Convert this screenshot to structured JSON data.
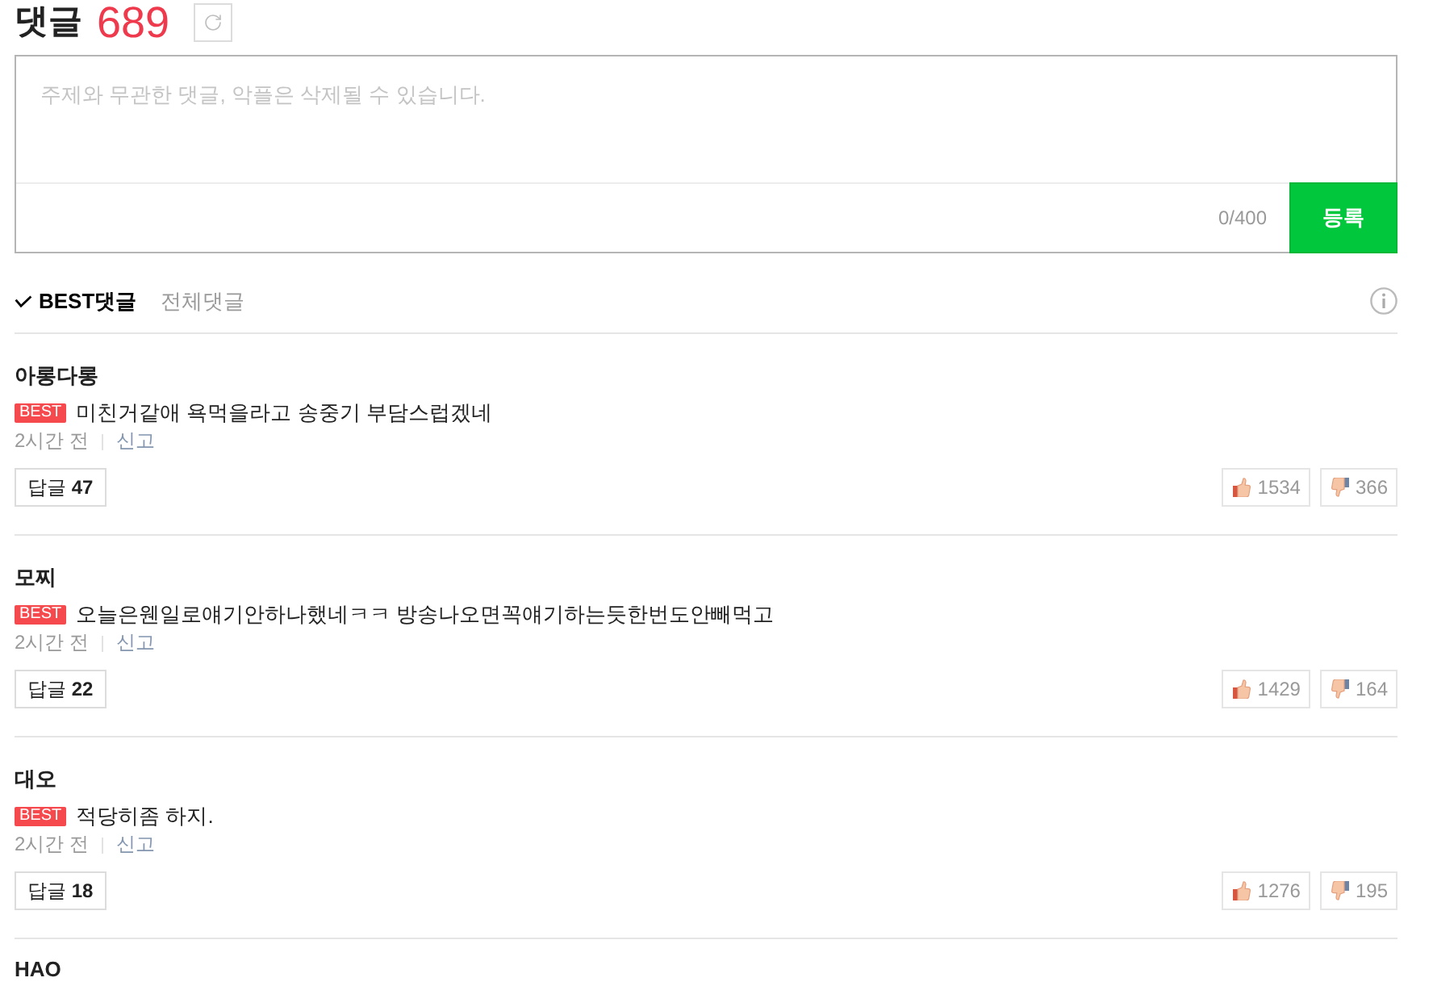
{
  "header": {
    "title": "댓글",
    "count": "689"
  },
  "comment_form": {
    "placeholder": "주제와 무관한 댓글, 악플은 삭제될 수 있습니다.",
    "char_count": "0/400",
    "submit_label": "등록"
  },
  "tabs": [
    {
      "label": "BEST댓글",
      "selected": true
    },
    {
      "label": "전체댓글",
      "selected": false
    }
  ],
  "comments": [
    {
      "author": "아롱다롱",
      "badge": "BEST",
      "text": "미친거같애 욕먹을라고 송중기 부담스럽겠네",
      "time": "2시간 전",
      "report": "신고",
      "replies": "답글 **47**",
      "likes": "1534",
      "dislikes": "366"
    },
    {
      "author": "모찌",
      "badge": "BEST",
      "text": "오늘은웬일로얘기안하나했네ㅋㅋ 방송나오면꼭얘기하는듯한번도안빼먹고",
      "time": "2시간 전",
      "report": "신고",
      "replies": "답글 **22**",
      "likes": "1429",
      "dislikes": "164"
    },
    {
      "author": "대오",
      "badge": "BEST",
      "text": "적당히좀 하지.",
      "time": "2시간 전",
      "report": "신고",
      "replies": "답글 **18**",
      "likes": "1276",
      "dislikes": "195"
    },
    {
      "author": "HAO"
    }
  ]
}
